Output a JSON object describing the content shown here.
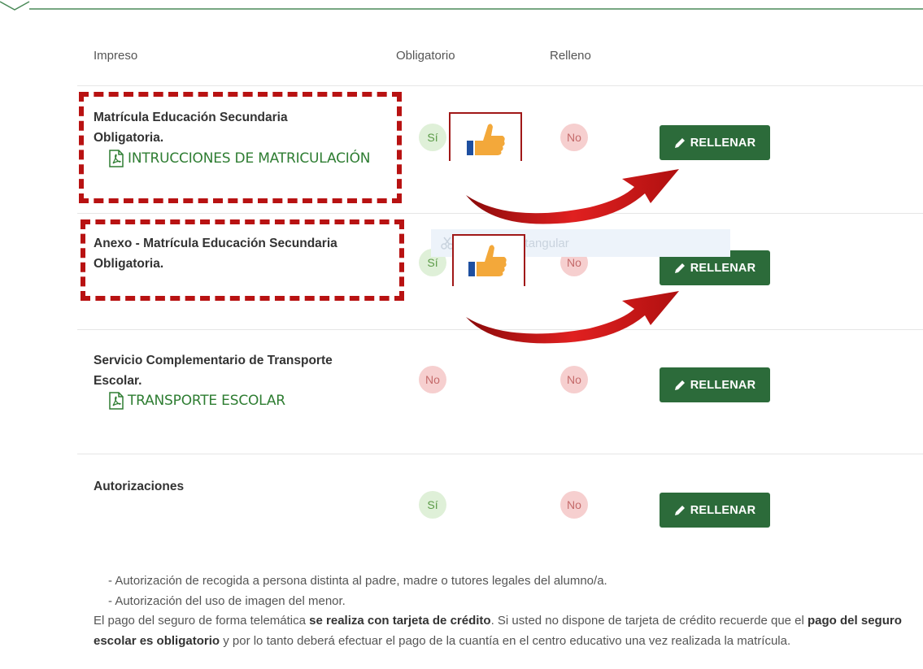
{
  "table": {
    "headers": {
      "impreso": "Impreso",
      "obligatorio": "Obligatorio",
      "relleno": "Relleno"
    },
    "rows": [
      {
        "title": "Matrícula Educación Secundaria Obligatoria.",
        "link": "INTRUCCIONES DE MATRICULACIÓN",
        "obligatorio": "Sí",
        "relleno": "No",
        "button": "RELLENAR"
      },
      {
        "title": "Anexo - Matrícula Educación Secundaria Obligatoria.",
        "obligatorio": "Sí",
        "relleno": "No",
        "button": "RELLENAR"
      },
      {
        "title": "Servicio Complementario de Transporte Escolar.",
        "link": "TRANSPORTE ESCOLAR",
        "obligatorio": "No",
        "relleno": "No",
        "button": "RELLENAR"
      },
      {
        "title": "Autorizaciones",
        "obligatorio": "Sí",
        "relleno": "No",
        "button": "RELLENAR"
      }
    ]
  },
  "overlay": {
    "ghost_text": "Recorte rectangular"
  },
  "notes": {
    "bullet1": "- Autorización de recogida a persona distinta al padre, madre o tutores legales del alumno/a.",
    "bullet2": "- Autorización del uso de imagen del menor.",
    "p_a": "El pago del seguro de forma telemática ",
    "p_b": "se realiza con tarjeta de crédito",
    "p_c": ". Si usted no dispone de tarjeta de crédito recuerde que el ",
    "p_d": "pago del seguro escolar es obligatorio",
    "p_e": " y por lo tanto deberá efectuar el pago de la cuantía en el centro educativo una vez realizada la matrícula."
  },
  "colors": {
    "accent_green": "#2c6b3a",
    "annotation_red": "#b81212",
    "si_bg": "#dff0d8",
    "no_bg": "#f6cfcf"
  }
}
